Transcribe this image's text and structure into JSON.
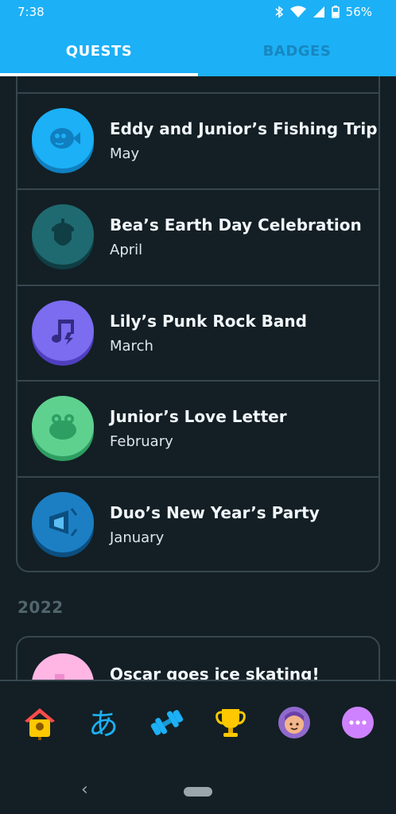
{
  "status_bar": {
    "time": "7:38",
    "battery": "56%"
  },
  "tabs": [
    {
      "label": "QUESTS",
      "active": true
    },
    {
      "label": "BADGES",
      "active": false
    }
  ],
  "quests": [
    {
      "title": "Eddy and Junior’s Fishing Trip",
      "month": "May",
      "icon": "pufferfish-badge-icon",
      "color": "#1cb0f6"
    },
    {
      "title": "Bea’s Earth Day Celebration",
      "month": "April",
      "icon": "acorn-badge-icon",
      "color": "#1f6a70"
    },
    {
      "title": "Lily’s Punk Rock Band",
      "month": "March",
      "icon": "music-note-badge-icon",
      "color": "#7b6cf0"
    },
    {
      "title": "Junior’s Love Letter",
      "month": "February",
      "icon": "frog-badge-icon",
      "color": "#5ed18f"
    },
    {
      "title": "Duo’s New Year’s Party",
      "month": "January",
      "icon": "party-horn-badge-icon",
      "color": "#1c7fc4"
    }
  ],
  "year_header": "2022",
  "next_quest": {
    "title": "Oscar goes ice skating!",
    "icon": "ice-skate-badge-icon",
    "color": "#ffb6e4"
  },
  "bottom_nav": [
    {
      "name": "home-tab",
      "icon": "birdhouse-icon"
    },
    {
      "name": "characters-tab",
      "icon": "hiragana-a-icon",
      "glyph": "あ"
    },
    {
      "name": "practice-tab",
      "icon": "dumbbell-icon"
    },
    {
      "name": "leaderboard-tab",
      "icon": "trophy-icon"
    },
    {
      "name": "profile-tab",
      "icon": "avatar-icon"
    },
    {
      "name": "more-tab",
      "icon": "more-dots-icon"
    }
  ]
}
